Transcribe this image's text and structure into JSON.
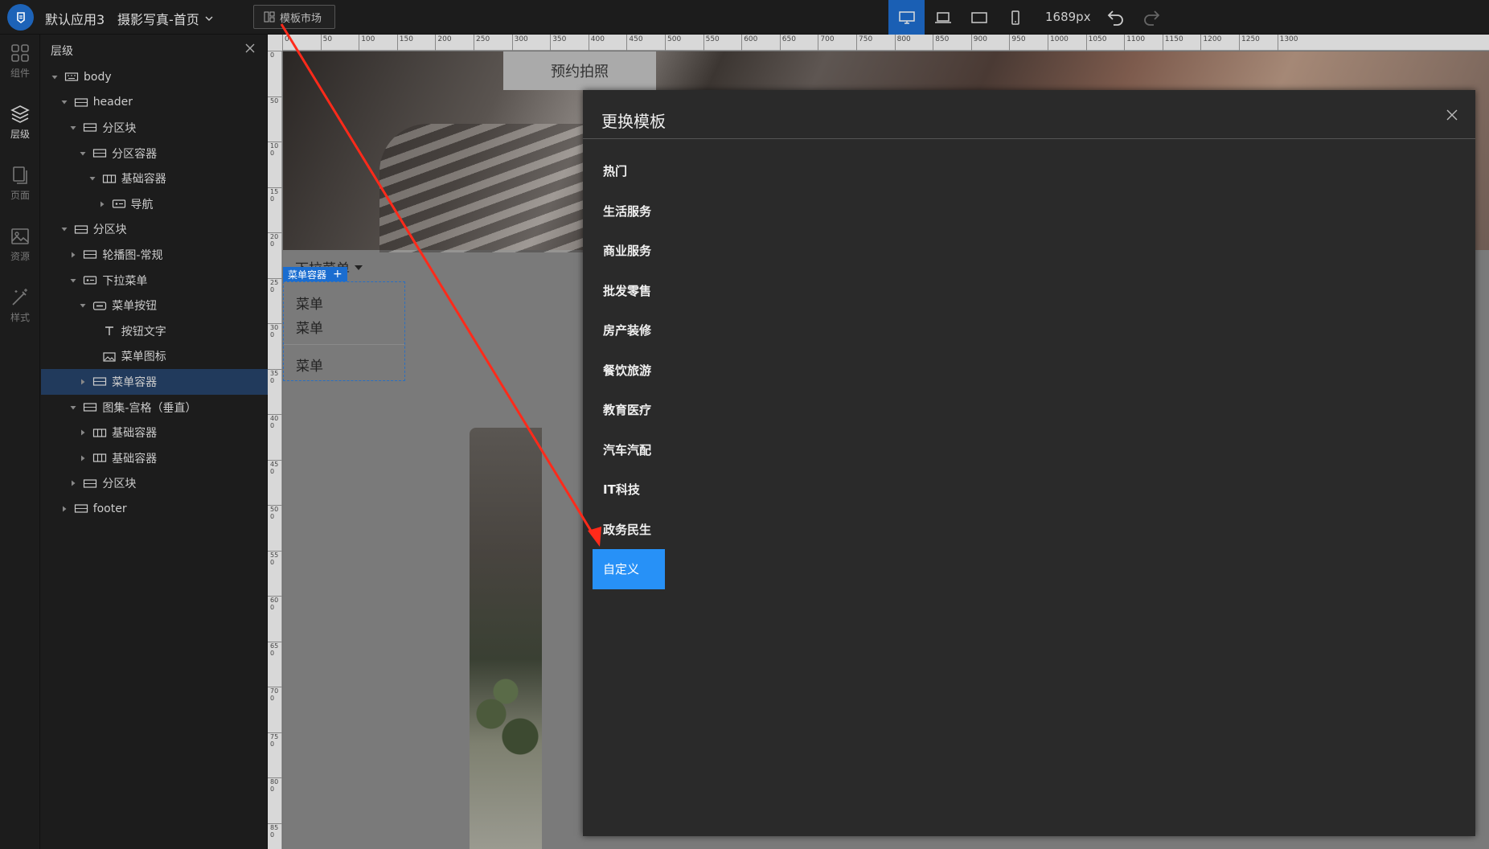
{
  "topbar": {
    "app_name": "默认应用3",
    "page_name": "摄影写真-首页",
    "market_button": "模板市场",
    "width_label": "1689px",
    "active_device": "desktop"
  },
  "rail": {
    "items": [
      {
        "label": "组件",
        "icon": "grid-icon"
      },
      {
        "label": "层级",
        "icon": "layers-icon"
      },
      {
        "label": "页面",
        "icon": "pages-icon"
      },
      {
        "label": "资源",
        "icon": "image-icon"
      },
      {
        "label": "样式",
        "icon": "magic-wand-icon"
      }
    ],
    "active": "层级"
  },
  "layer_panel": {
    "title": "层级",
    "tree": [
      {
        "label": "body",
        "depth": 0,
        "arrow": "down"
      },
      {
        "label": "header",
        "depth": 1,
        "arrow": "down"
      },
      {
        "label": "分区块",
        "depth": 2,
        "arrow": "down"
      },
      {
        "label": "分区容器",
        "depth": 3,
        "arrow": "down"
      },
      {
        "label": "基础容器",
        "depth": 4,
        "arrow": "down"
      },
      {
        "label": "导航",
        "depth": 5,
        "arrow": "right"
      },
      {
        "label": "分区块",
        "depth": 1,
        "arrow": "down"
      },
      {
        "label": "轮播图-常规",
        "depth": 2,
        "arrow": "right"
      },
      {
        "label": "下拉菜单",
        "depth": 2,
        "arrow": "down"
      },
      {
        "label": "菜单按钮",
        "depth": 3,
        "arrow": "down"
      },
      {
        "label": "按钮文字",
        "depth": 4,
        "arrow": "none"
      },
      {
        "label": "菜单图标",
        "depth": 4,
        "arrow": "none"
      },
      {
        "label": "菜单容器",
        "depth": 3,
        "arrow": "right",
        "selected": true
      },
      {
        "label": "图集-宫格（垂直）",
        "depth": 2,
        "arrow": "down"
      },
      {
        "label": "基础容器",
        "depth": 3,
        "arrow": "right"
      },
      {
        "label": "基础容器",
        "depth": 3,
        "arrow": "right"
      },
      {
        "label": "分区块",
        "depth": 2,
        "arrow": "right"
      },
      {
        "label": "footer",
        "depth": 1,
        "arrow": "right"
      }
    ]
  },
  "canvas": {
    "ruler_top": [
      "0",
      "50",
      "100",
      "150",
      "200",
      "250",
      "300",
      "350",
      "400",
      "450",
      "500",
      "550",
      "600",
      "650",
      "700",
      "750",
      "800",
      "850",
      "900",
      "950",
      "1000",
      "1050",
      "1100",
      "1150",
      "1200",
      "1250",
      "1300"
    ],
    "ruler_left": [
      "0",
      "50",
      "100",
      "150",
      "200",
      "250",
      "300",
      "350",
      "400",
      "450",
      "500",
      "550",
      "600",
      "650",
      "700",
      "750",
      "800",
      "850"
    ],
    "book_button": "预约拍照",
    "dropdown_label": "下拉菜单",
    "menu_container_tag": "菜单容器",
    "menu_items": [
      "菜单",
      "菜单",
      "菜单"
    ]
  },
  "modal": {
    "title": "更换模板",
    "categories": [
      "热门",
      "生活服务",
      "商业服务",
      "批发零售",
      "房产装修",
      "餐饮旅游",
      "教育医疗",
      "汽车汽配",
      "IT科技",
      "政务民生",
      "自定义"
    ],
    "active_category": "自定义"
  },
  "colors": {
    "accent": "#2791f7",
    "selected_row": "#213a5c",
    "annotation_arrow": "#ff2a1a"
  }
}
